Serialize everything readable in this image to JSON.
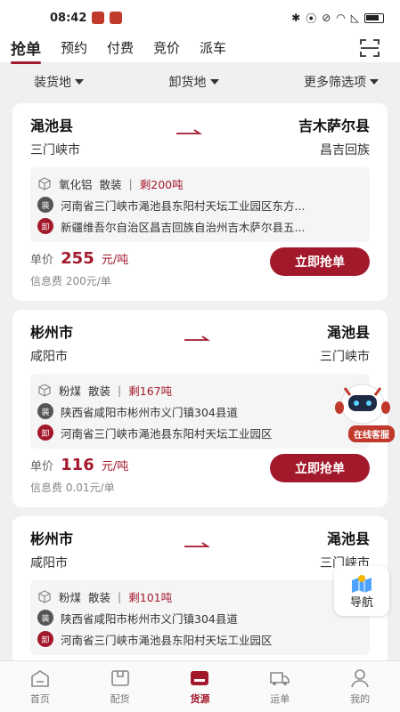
{
  "status_bar": {
    "time": "08:42"
  },
  "top_tabs": [
    {
      "label": "抢单",
      "active": true
    },
    {
      "label": "预约",
      "active": false
    },
    {
      "label": "付费",
      "active": false
    },
    {
      "label": "竞价",
      "active": false
    },
    {
      "label": "派车",
      "active": false
    }
  ],
  "filters": [
    {
      "label": "装货地"
    },
    {
      "label": "卸货地"
    },
    {
      "label": "更多筛选项"
    }
  ],
  "cards": [
    {
      "from_city": "渑池县",
      "from_sub": "三门峡市",
      "to_city": "吉木萨尔县",
      "to_sub": "昌吉回族",
      "goods": "氧化铝",
      "pack": "散装",
      "divider": "|",
      "remain": "剩200吨",
      "load_badge": "装",
      "load_addr": "河南省三门峡市渑池县东阳村天坛工业园区东方...",
      "unload_badge": "卸",
      "unload_addr": "新疆维吾尔自治区昌吉回族自治州吉木萨尔县五...",
      "price_label": "单价",
      "price_value": "255",
      "price_unit": "元/吨",
      "fee": "信息费 200元/单",
      "button": "立即抢单"
    },
    {
      "from_city": "彬州市",
      "from_sub": "咸阳市",
      "to_city": "渑池县",
      "to_sub": "三门峡市",
      "goods": "粉煤",
      "pack": "散装",
      "divider": "|",
      "remain": "剩167吨",
      "load_badge": "装",
      "load_addr": "陕西省咸阳市彬州市义门镇304县道",
      "unload_badge": "卸",
      "unload_addr": "河南省三门峡市渑池县东阳村天坛工业园区",
      "price_label": "单价",
      "price_value": "116",
      "price_unit": "元/吨",
      "fee": "信息费 0.01元/单",
      "button": "立即抢单"
    },
    {
      "from_city": "彬州市",
      "from_sub": "咸阳市",
      "to_city": "渑池县",
      "to_sub": "三门峡市",
      "goods": "粉煤",
      "pack": "散装",
      "divider": "|",
      "remain": "剩101吨",
      "load_badge": "装",
      "load_addr": "陕西省咸阳市彬州市义门镇304县道",
      "unload_badge": "卸",
      "unload_addr": "河南省三门峡市渑池县东阳村天坛工业园区"
    }
  ],
  "floating": {
    "service_label": "在线客服",
    "nav_label": "导航"
  },
  "bottom_nav": [
    {
      "label": "首页",
      "icon": "home-icon",
      "active": false
    },
    {
      "label": "配货",
      "icon": "box-icon",
      "active": false
    },
    {
      "label": "货源",
      "icon": "cargo-icon",
      "active": true
    },
    {
      "label": "运单",
      "icon": "truck-icon",
      "active": false
    },
    {
      "label": "我的",
      "icon": "user-icon",
      "active": false
    }
  ],
  "colors": {
    "accent": "#a3192c",
    "background": "#f0f0f2"
  }
}
